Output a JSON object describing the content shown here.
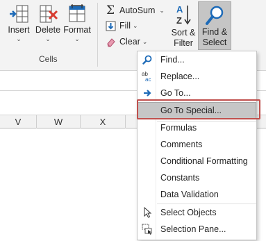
{
  "ribbon": {
    "insert": {
      "label": "Insert",
      "icon": "insert-cells-icon"
    },
    "delete": {
      "label": "Delete",
      "icon": "delete-cells-icon"
    },
    "format": {
      "label": "Format",
      "icon": "format-cells-icon"
    },
    "cells_group_label": "Cells",
    "autosum": {
      "label": "AutoSum",
      "icon": "sigma-icon"
    },
    "fill": {
      "label": "Fill",
      "icon": "fill-down-icon"
    },
    "clear": {
      "label": "Clear",
      "icon": "eraser-icon"
    },
    "sort_filter": {
      "line1": "Sort &",
      "line2": "Filter",
      "icon": "sort-az-icon"
    },
    "find_select": {
      "line1": "Find &",
      "line2": "Select",
      "icon": "magnifier-icon"
    }
  },
  "columns": [
    "V",
    "W",
    "X"
  ],
  "menu": {
    "items": [
      {
        "label": "Find...",
        "icon": "find-icon"
      },
      {
        "label": "Replace...",
        "icon": "replace-icon"
      },
      {
        "label": "Go To...",
        "icon": "arrow-right-icon"
      },
      {
        "label": "Go To Special...",
        "icon": ""
      },
      {
        "label": "Formulas",
        "icon": ""
      },
      {
        "label": "Comments",
        "icon": ""
      },
      {
        "label": "Conditional Formatting",
        "icon": ""
      },
      {
        "label": "Constants",
        "icon": ""
      },
      {
        "label": "Data Validation",
        "icon": ""
      },
      {
        "label": "Select Objects",
        "icon": "cursor-arrow-icon"
      },
      {
        "label": "Selection Pane...",
        "icon": "selection-pane-icon"
      }
    ],
    "highlighted_index": 3
  },
  "colors": {
    "ribbon_bg": "#f3f3f3",
    "highlight": "#c6c6c6",
    "focus_outline": "#c0504d",
    "accent_blue": "#1e6bb8",
    "delete_red": "#d83b2f"
  }
}
